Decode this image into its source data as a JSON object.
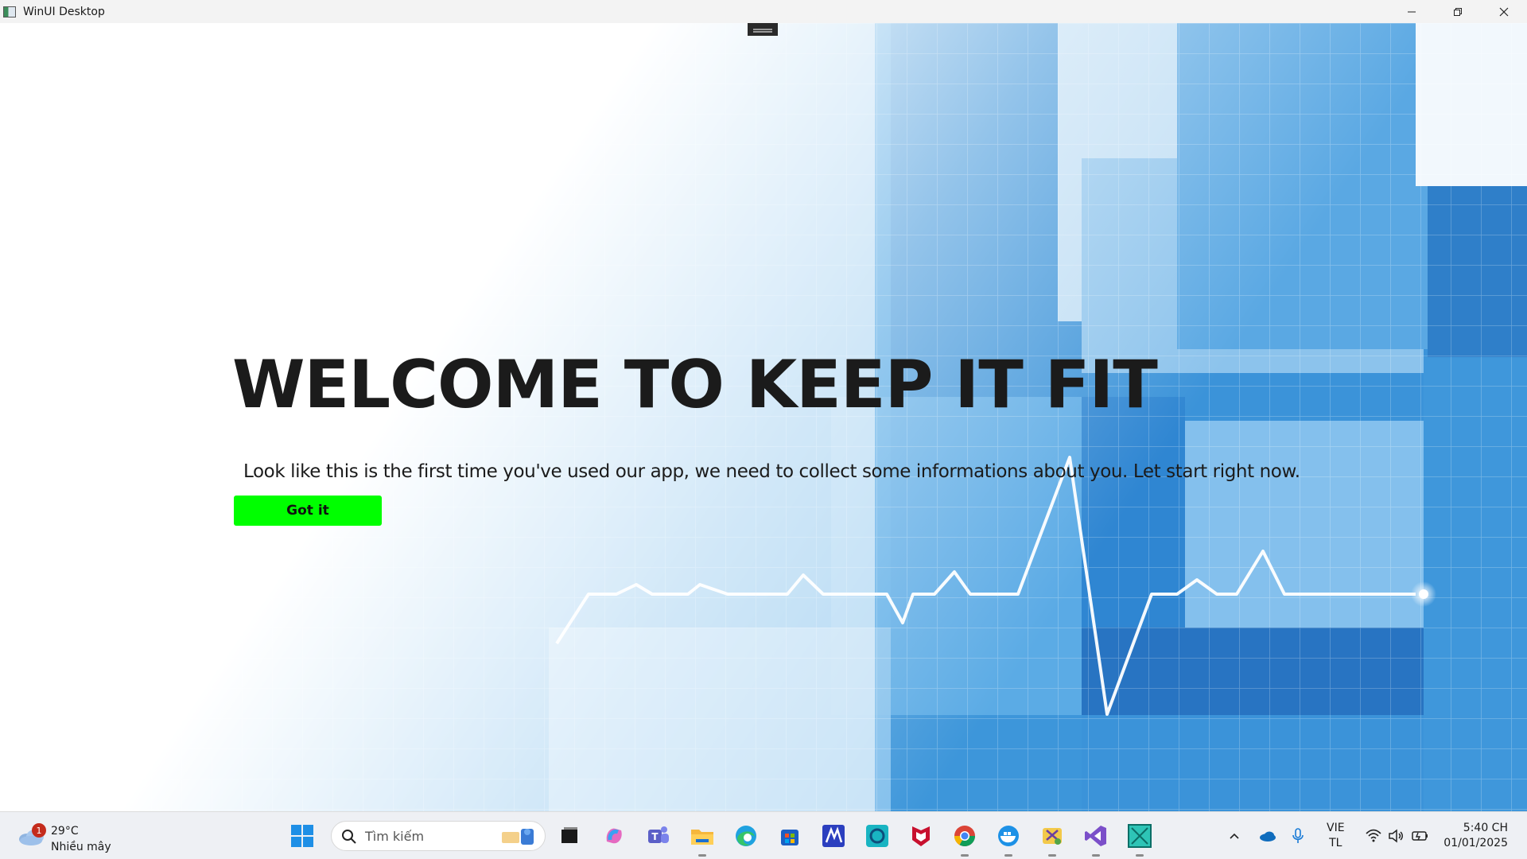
{
  "window": {
    "title": "WinUI Desktop",
    "controls": [
      "minimize-icon",
      "restore-icon",
      "close-icon"
    ]
  },
  "main": {
    "heading": "WELCOME TO KEEP IT FIT",
    "subtitle": "Look like this is the first time you've used our app, we need to collect some informations about you. Let start right now.",
    "button_label": "Got it",
    "button_color": "#00ff00"
  },
  "taskbar": {
    "weather": {
      "badge": "1",
      "temperature": "29°C",
      "description": "Nhiều mây",
      "icon": "cloud-icon"
    },
    "search_placeholder": "Tìm kiếm",
    "apps": [
      "start-icon",
      "task-view-icon",
      "copilot-icon",
      "teams-icon",
      "file-explorer-icon",
      "edge-icon",
      "store-icon",
      "vs-code-like-icon",
      "cortana-icon",
      "mcafee-icon",
      "chrome-icon",
      "docker-icon",
      "snipping-tool-icon",
      "visual-studio-icon",
      "xaml-app-icon"
    ],
    "tray": {
      "language_top": "VIE",
      "language_bottom": "TL",
      "time": "5:40 CH",
      "date": "01/01/2025",
      "icons": [
        "chevron-up-icon",
        "onedrive-icon",
        "microphone-icon",
        "wifi-icon",
        "volume-icon",
        "battery-icon"
      ]
    }
  },
  "colors": {
    "accent_blue": "#1f7fd6",
    "titlebar": "#f3f3f3",
    "taskbar": "#eef0f4"
  }
}
